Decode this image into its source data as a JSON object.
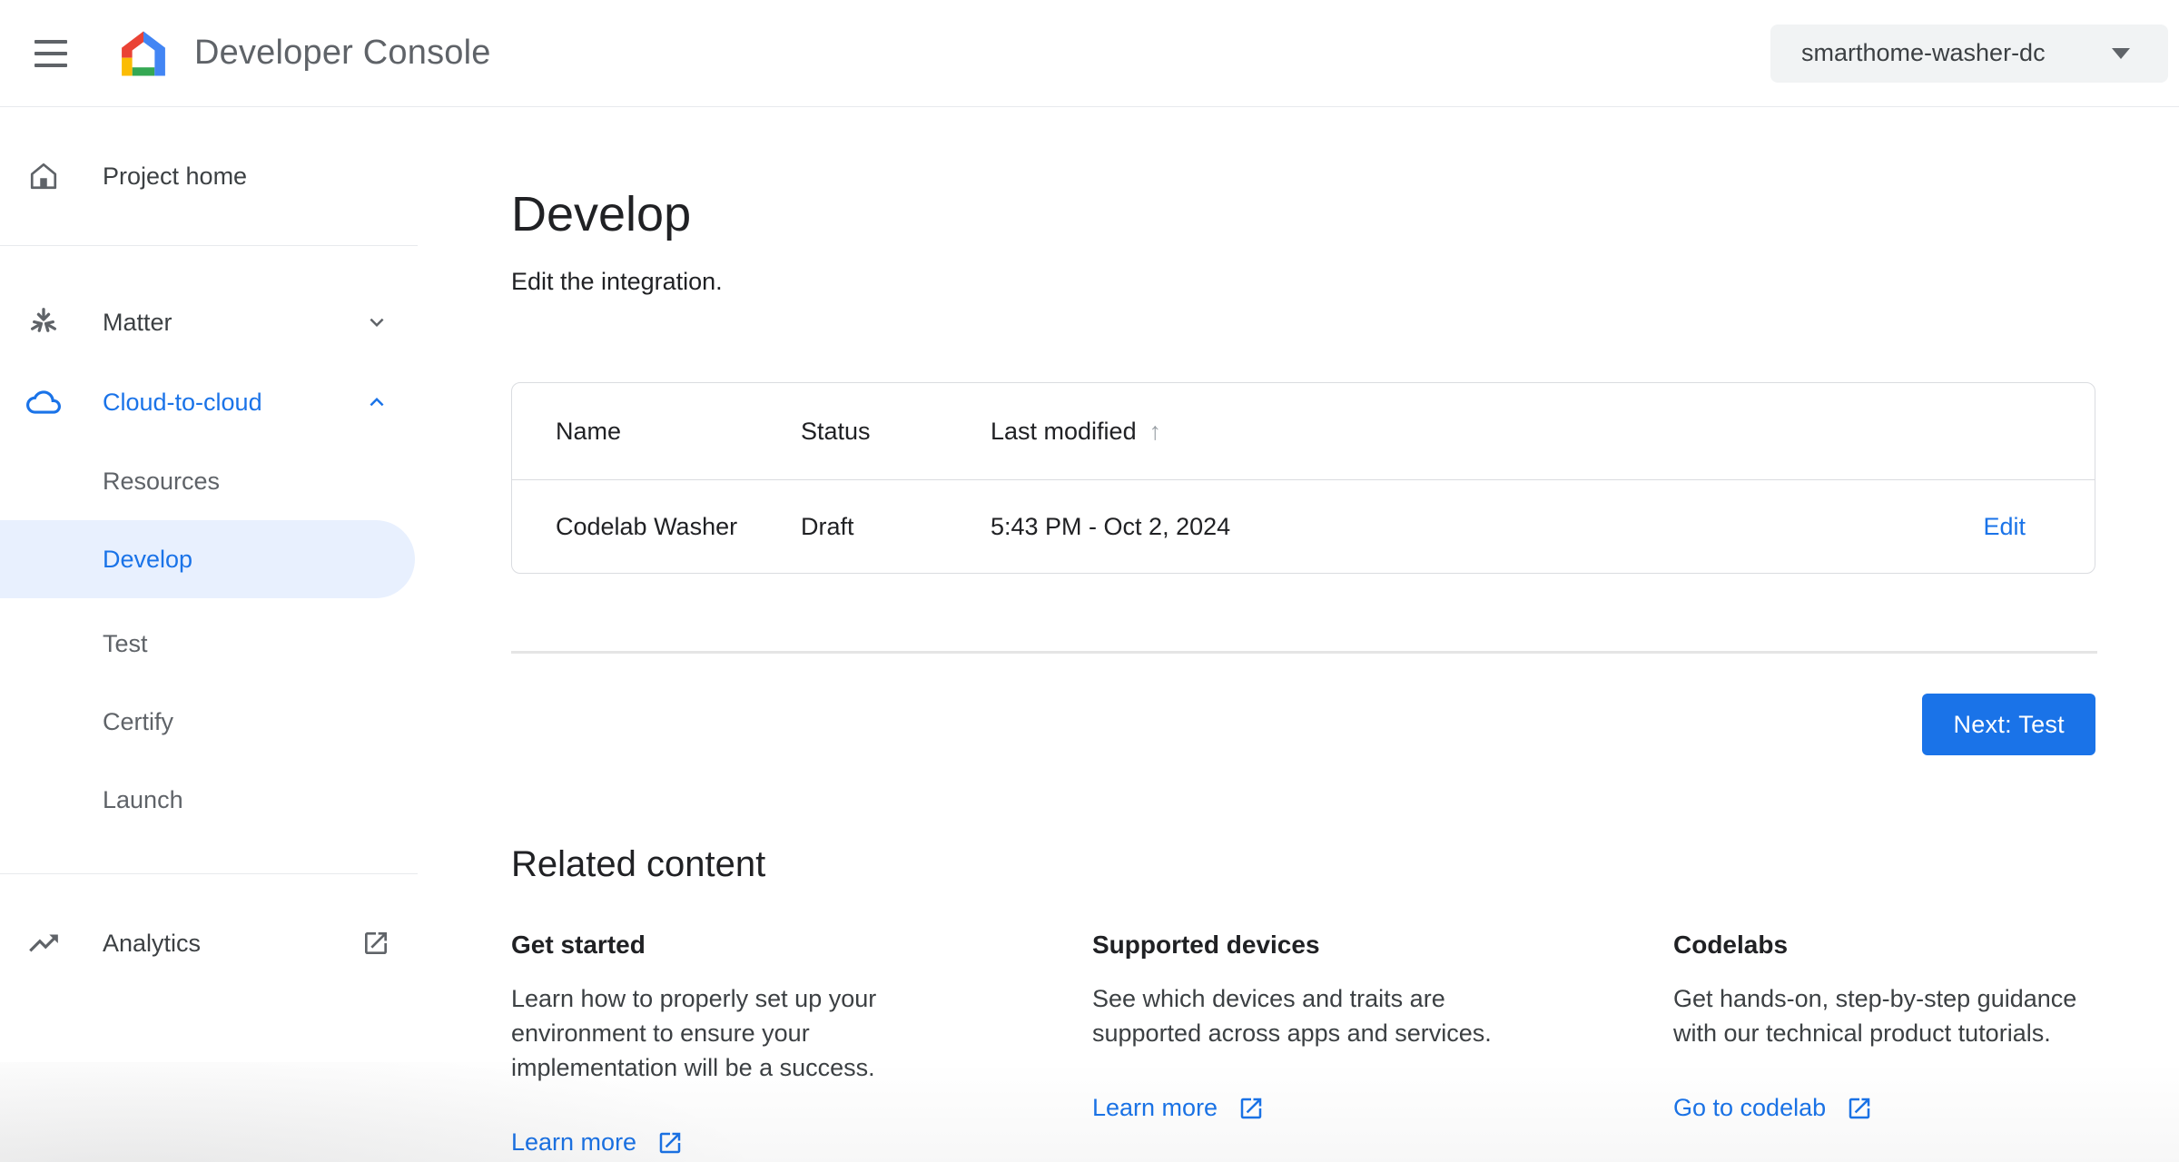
{
  "header": {
    "title": "Developer Console",
    "project_selector": "smarthome-washer-dc"
  },
  "sidebar": {
    "project_home": "Project home",
    "matter": "Matter",
    "cloud_to_cloud": "Cloud-to-cloud",
    "resources": "Resources",
    "develop": "Develop",
    "test": "Test",
    "certify": "Certify",
    "launch": "Launch",
    "analytics": "Analytics"
  },
  "main": {
    "title": "Develop",
    "subtitle": "Edit the integration.",
    "table": {
      "columns": [
        "Name",
        "Status",
        "Last modified"
      ],
      "sort_icon": "↑",
      "rows": [
        {
          "name": "Codelab Washer",
          "status": "Draft",
          "last_modified": "5:43 PM - Oct 2, 2024",
          "action": "Edit"
        }
      ]
    },
    "next_button": "Next: Test",
    "related": {
      "heading": "Related content",
      "cards": [
        {
          "title": "Get started",
          "body": "Learn how to properly set up your environment to ensure your implementation will be a success.",
          "link": "Learn more"
        },
        {
          "title": "Supported devices",
          "body": "See which devices and traits are supported across apps and services.",
          "link": "Learn more"
        },
        {
          "title": "Codelabs",
          "body": "Get hands-on, step-by-step guidance with our technical product tutorials.",
          "link": "Go to codelab"
        }
      ]
    }
  },
  "icons": {
    "hamburger": "menu-three-bars",
    "logo": "google-home-house",
    "project_home": "home-outline",
    "matter": "matter-tri-arrow",
    "cloud_to_cloud": "cloud-outline",
    "chevron_down": "▾",
    "chevron_up": "▴",
    "analytics": "trending-up",
    "external_link": "open-in-new",
    "sort_ascending": "↑",
    "selector_caret": "▼"
  },
  "colors": {
    "accent_blue": "#1a73e8",
    "selected_item_bg": "#e8f0fe",
    "header_text": "#5f6368",
    "body_text": "#202124",
    "secondary_text": "#5f6368",
    "border": "#dadce0",
    "selector_bg": "#f1f3f4",
    "logo_red": "#ea4335",
    "logo_blue": "#4285f4",
    "logo_yellow": "#fbbc04",
    "logo_green": "#34a853"
  }
}
